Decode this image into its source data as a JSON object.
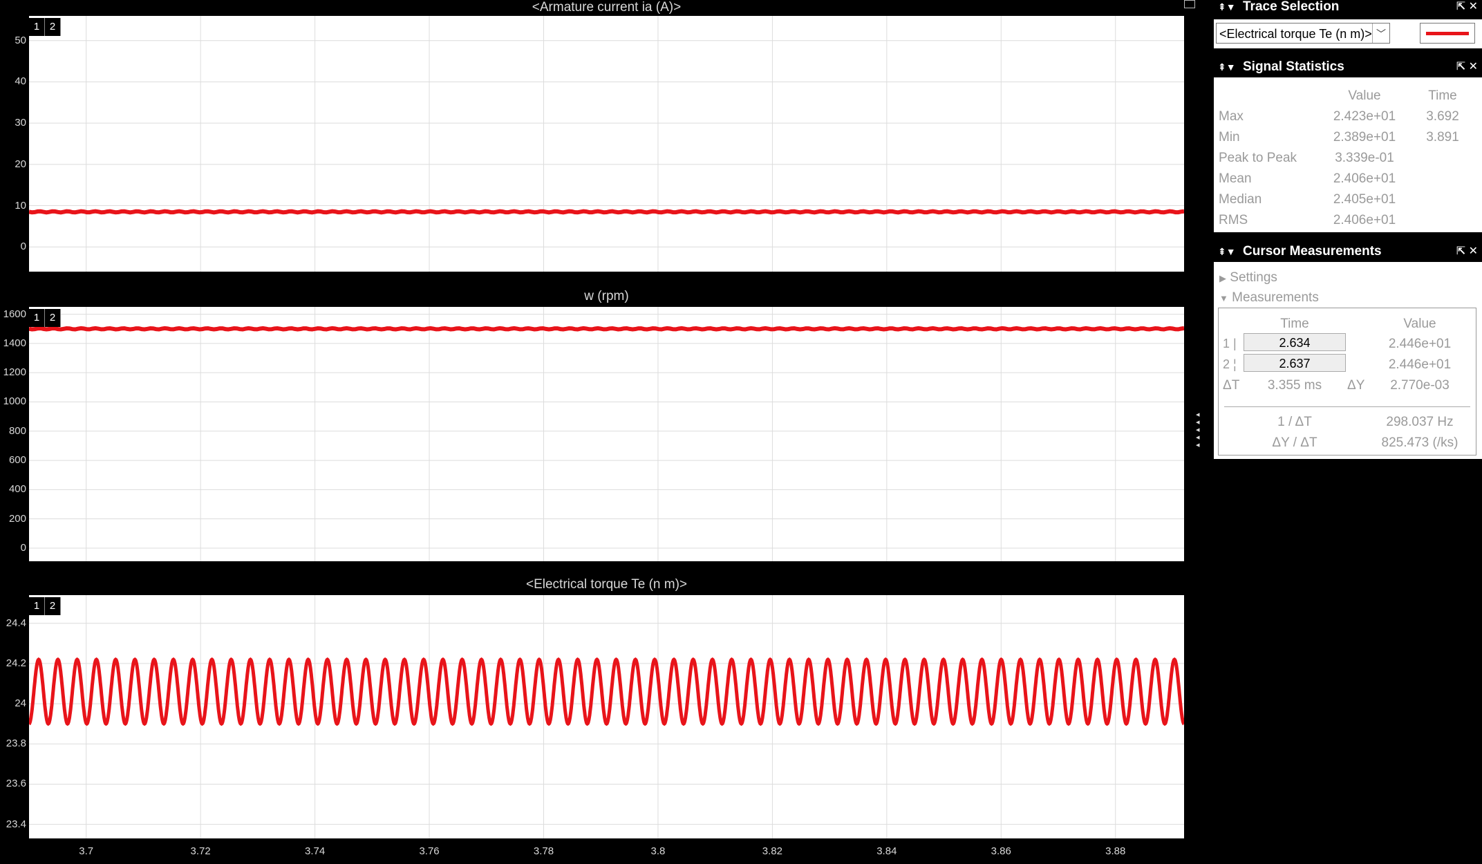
{
  "plots": [
    {
      "title": "<Armature current ia (A)>",
      "yticks": [
        "50",
        "40",
        "30",
        "20",
        "10",
        "0"
      ],
      "ylim": [
        -6,
        56
      ],
      "trace": {
        "type": "flat",
        "value": 8.5
      }
    },
    {
      "title": "w (rpm)",
      "yticks": [
        "1600",
        "1400",
        "1200",
        "1000",
        "800",
        "600",
        "400",
        "200",
        "0"
      ],
      "ylim": [
        -90,
        1650
      ],
      "trace": {
        "type": "flat",
        "value": 1500
      }
    },
    {
      "title": "<Electrical torque Te (n m)>",
      "yticks": [
        "24.4",
        "24.2",
        "24",
        "23.8",
        "23.6",
        "23.4"
      ],
      "ylim": [
        23.33,
        24.54
      ],
      "trace": {
        "type": "sine",
        "mean": 24.06,
        "amplitude": 0.16,
        "cycles": 60
      }
    }
  ],
  "plot_tags": [
    "1",
    "2"
  ],
  "xaxis": {
    "ticks": [
      "3.7",
      "3.72",
      "3.74",
      "3.76",
      "3.78",
      "3.8",
      "3.82",
      "3.84",
      "3.86",
      "3.88"
    ],
    "xlim": [
      3.69,
      3.892
    ]
  },
  "trace_color": "#e8141a",
  "trace_selection": {
    "title": "Trace Selection",
    "selected": "<Electrical torque Te (n m)>"
  },
  "signal_statistics": {
    "title": "Signal Statistics",
    "headers": {
      "value": "Value",
      "time": "Time"
    },
    "rows": [
      {
        "label": "Max",
        "value": "2.423e+01",
        "time": "3.692"
      },
      {
        "label": "Min",
        "value": "2.389e+01",
        "time": "3.891"
      },
      {
        "label": "Peak to Peak",
        "value": "3.339e-01",
        "time": ""
      },
      {
        "label": "Mean",
        "value": "2.406e+01",
        "time": ""
      },
      {
        "label": "Median",
        "value": "2.405e+01",
        "time": ""
      },
      {
        "label": "RMS",
        "value": "2.406e+01",
        "time": ""
      }
    ]
  },
  "cursor_measurements": {
    "title": "Cursor Measurements",
    "settings_label": "Settings",
    "measurements_label": "Measurements",
    "headers": {
      "time": "Time",
      "value": "Value"
    },
    "cursor1": {
      "id": "1 |",
      "time": "2.634",
      "value": "2.446e+01"
    },
    "cursor2": {
      "id": "2 ¦",
      "time": "2.637",
      "value": "2.446e+01"
    },
    "delta_t_label": "ΔT",
    "delta_t": "3.355 ms",
    "delta_y_label": "ΔY",
    "delta_y": "2.770e-03",
    "inv_dt_label": "1 / ΔT",
    "inv_dt": "298.037 Hz",
    "dy_dt_label": "ΔY / ΔT",
    "dy_dt": "825.473 (/ks)"
  }
}
